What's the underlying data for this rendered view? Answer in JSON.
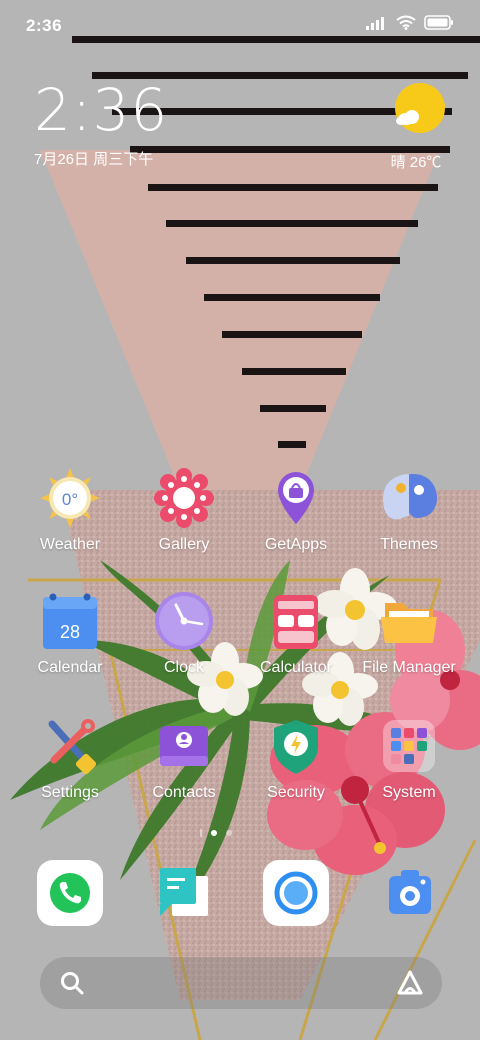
{
  "status_bar": {
    "time": "2:36",
    "icons": [
      "signal-icon",
      "wifi-icon",
      "battery-icon"
    ]
  },
  "clock": {
    "time": "2:36",
    "date": "7月26日 周三下午"
  },
  "weather": {
    "condition_icon": "sun-cloud-icon",
    "temp": "晴 26℃"
  },
  "apps": [
    {
      "label": "Weather",
      "icon": "weather-icon",
      "badge": "0°"
    },
    {
      "label": "Gallery",
      "icon": "gallery-icon"
    },
    {
      "label": "GetApps",
      "icon": "getapps-icon"
    },
    {
      "label": "Themes",
      "icon": "themes-icon"
    },
    {
      "label": "Calendar",
      "icon": "calendar-icon",
      "badge": "28"
    },
    {
      "label": "Clock",
      "icon": "clock-icon"
    },
    {
      "label": "Calculator",
      "icon": "calculator-icon"
    },
    {
      "label": "File Manager",
      "icon": "folder-icon"
    },
    {
      "label": "Settings",
      "icon": "settings-icon"
    },
    {
      "label": "Contacts",
      "icon": "contacts-icon"
    },
    {
      "label": "Security",
      "icon": "security-icon"
    },
    {
      "label": "System",
      "icon": "system-folder-icon"
    }
  ],
  "dock": [
    {
      "icon": "phone-icon"
    },
    {
      "icon": "messages-icon"
    },
    {
      "icon": "browser-icon"
    },
    {
      "icon": "camera-icon"
    }
  ],
  "page_indicator": {
    "pages": 2,
    "active": 0
  },
  "search": {
    "icons": [
      "search-icon",
      "assistant-icon"
    ]
  },
  "colors": {
    "wallpaper_gray": "#b5b5b5",
    "wallpaper_pink": "#d8b0a6",
    "stripe": "#1a1414",
    "gold": "#c9a64a"
  }
}
